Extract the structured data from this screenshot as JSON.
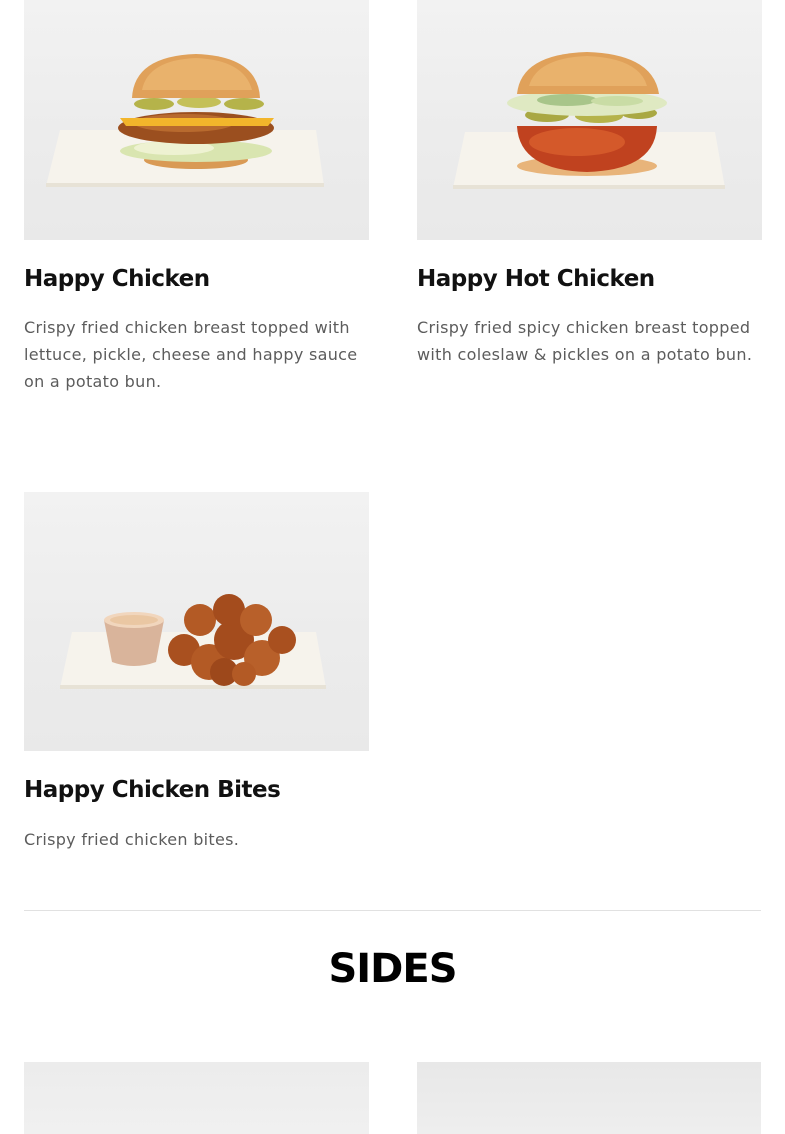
{
  "menu": {
    "items": [
      {
        "title": "Happy Chicken",
        "description": "Crispy fried chicken breast topped with lettuce, pickle, cheese and happy sauce on a potato bun.",
        "image": "chicken-sandwich-photo"
      },
      {
        "title": "Happy Hot Chicken",
        "description": "Crispy fried spicy chicken breast topped with coleslaw & pickles on a potato bun.",
        "image": "hot-chicken-sandwich-photo"
      },
      {
        "title": "Happy Chicken Bites",
        "description": "Crispy fried chicken bites.",
        "image": "chicken-bites-photo"
      }
    ]
  },
  "sides": {
    "heading": "SIDES",
    "items": [
      {
        "image": "side-photo"
      },
      {
        "image": "side-photo"
      }
    ]
  }
}
